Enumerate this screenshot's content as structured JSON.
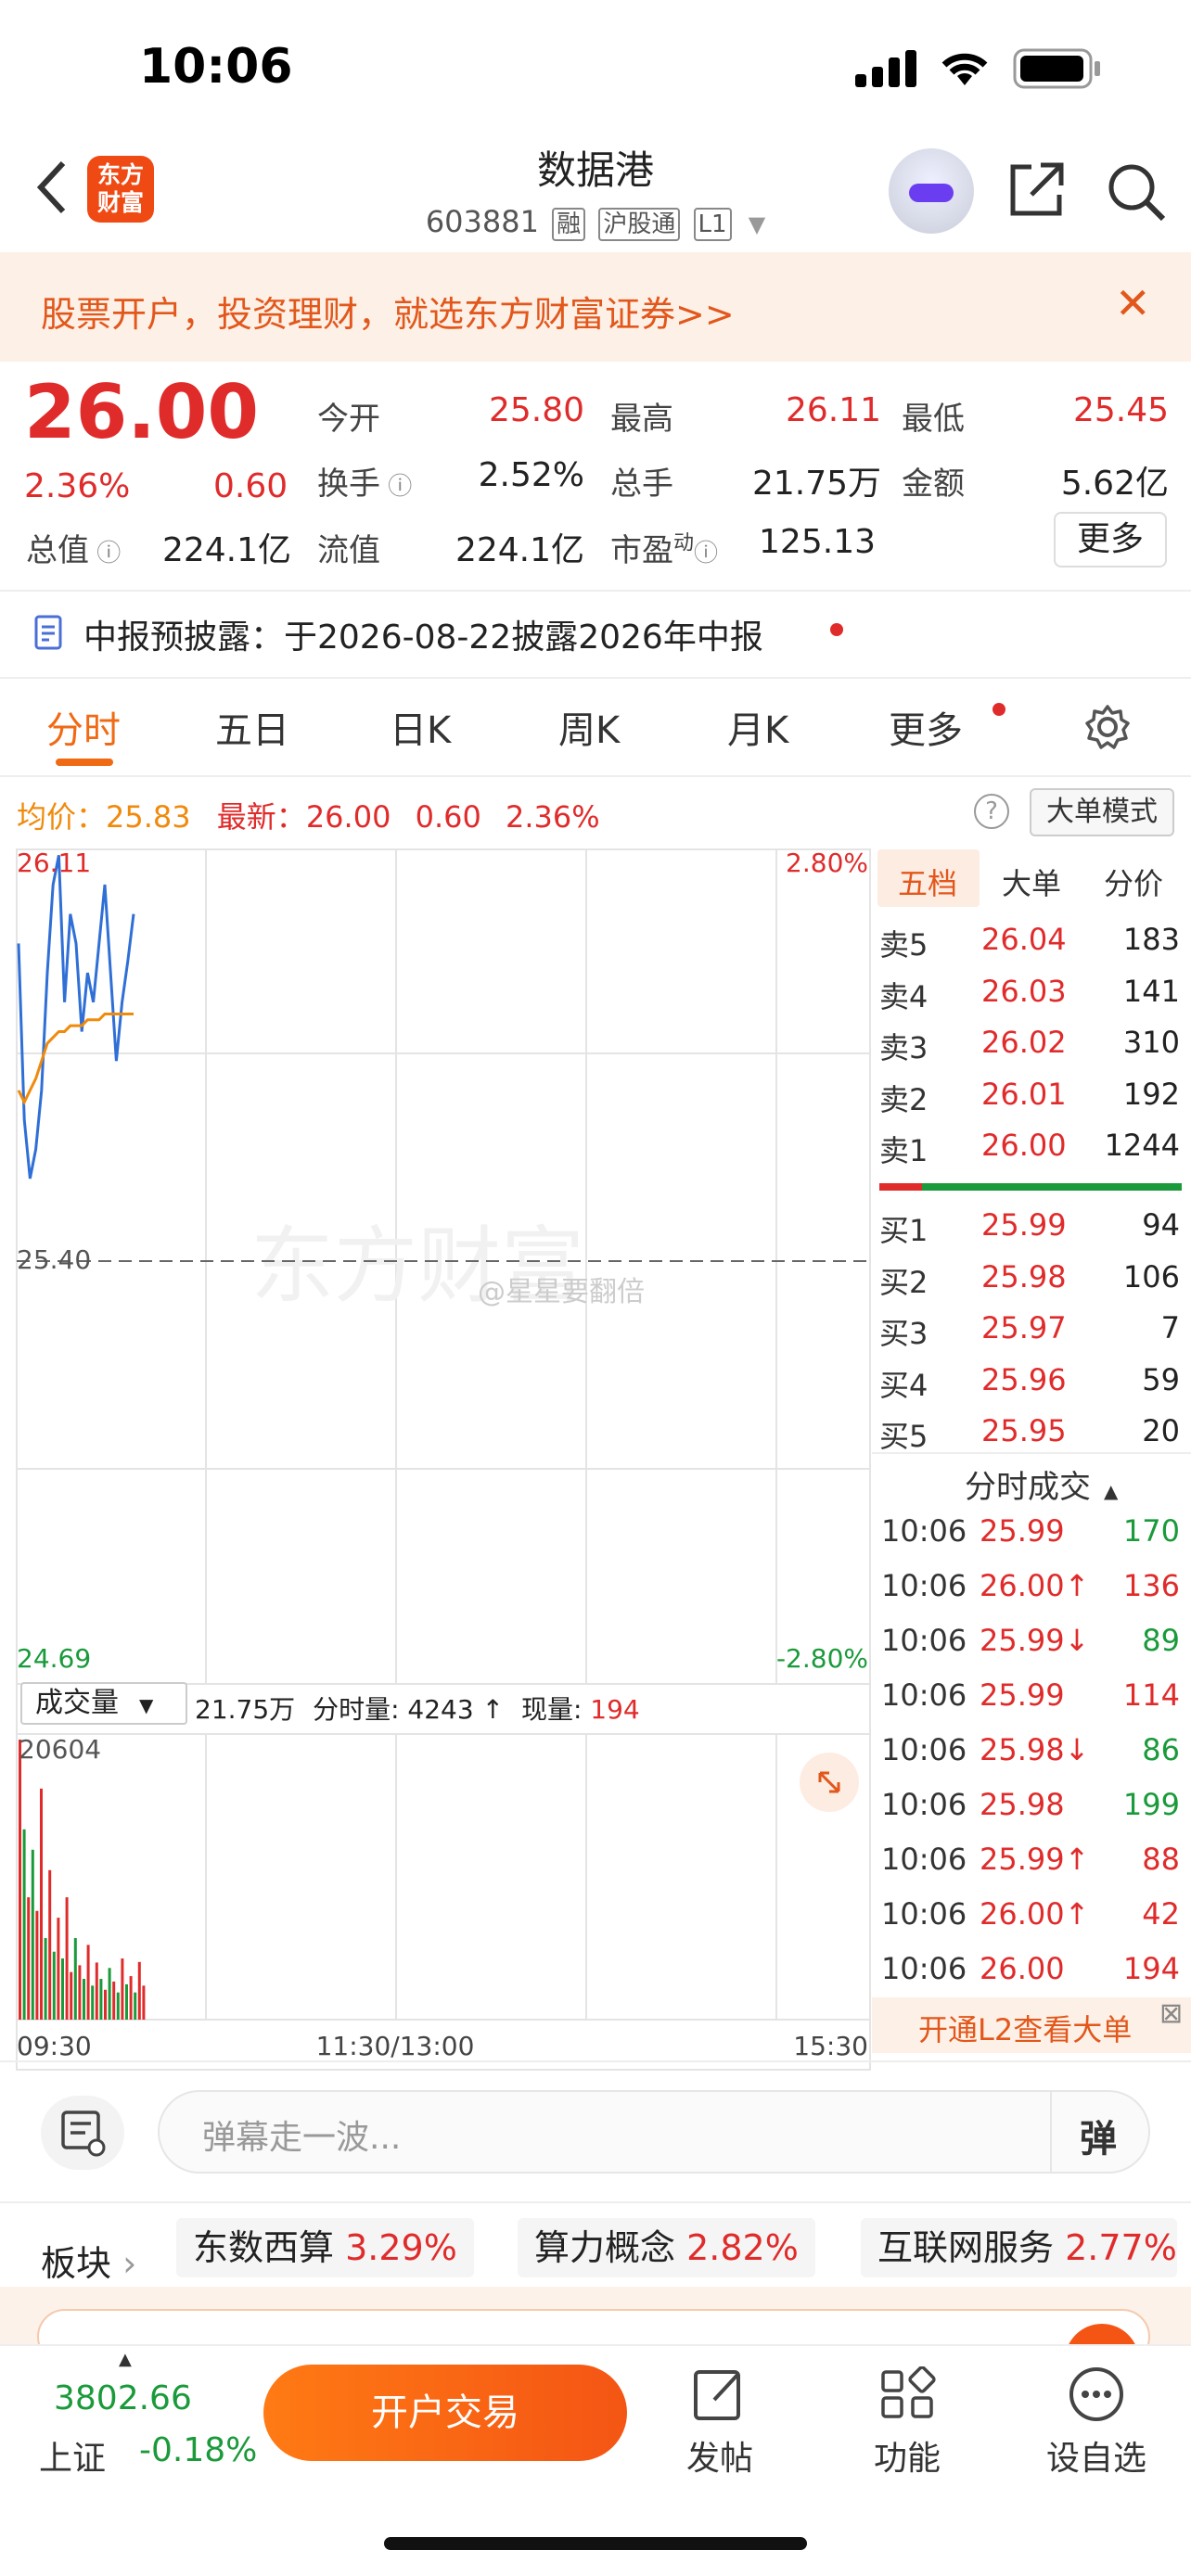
{
  "status": {
    "time": "10:06"
  },
  "header": {
    "logo_text": "东方\n财富",
    "title": "数据港",
    "code": "603881",
    "tags": [
      "融",
      "沪股通",
      "L1"
    ]
  },
  "promo": {
    "text": "股票开户，投资理财，就选东方财富证券>>"
  },
  "quote": {
    "price": "26.00",
    "change_pct": "2.36%",
    "change": "0.60",
    "open_label": "今开",
    "open": "25.80",
    "high_label": "最高",
    "high": "26.11",
    "low_label": "最低",
    "low": "25.45",
    "turnover_label": "换手",
    "turnover": "2.52%",
    "volume_label": "总手",
    "volume": "21.75万",
    "amount_label": "金额",
    "amount": "5.62亿",
    "mcap_label": "总值",
    "mcap": "224.1亿",
    "float_label": "流值",
    "float": "224.1亿",
    "pe_label": "市盈",
    "pe_sup": "动",
    "pe": "125.13",
    "more": "更多"
  },
  "notice": {
    "text": "中报预披露：于2026-08-22披露2026年中报"
  },
  "tabs": [
    "分时",
    "五日",
    "日K",
    "周K",
    "月K",
    "更多"
  ],
  "chart_info": {
    "avg_label": "均价：",
    "avg": "25.83",
    "last_label": "最新：",
    "last": "26.00",
    "chg": "0.60",
    "pct": "2.36%",
    "mode_button": "大单模式",
    "y_top": "26.11",
    "y_mid": "25.40",
    "y_bottom": "24.69",
    "pct_top": "2.80%",
    "pct_bottom": "-2.80%",
    "watermark": "东方财富",
    "weibo_mark": "@星星要翻倍",
    "vol_selector": "成交量",
    "vol_info_total": "21.75万",
    "vol_info_min_label": "分时量:",
    "vol_info_min": "4243",
    "vol_info_now_label": "现量:",
    "vol_info_now": "194",
    "vol_max": "20604",
    "x_start": "09:30",
    "x_mid": "11:30/13:00",
    "x_end": "15:30"
  },
  "chart_data": {
    "type": "line",
    "title": "",
    "ylim": [
      24.69,
      26.11
    ],
    "reference": 25.4,
    "series": [
      {
        "color": "#2f6fd6",
        "values": [
          25.95,
          25.65,
          25.55,
          25.6,
          25.7,
          25.9,
          26.05,
          26.1,
          25.85,
          26.0,
          25.95,
          25.8,
          25.9,
          25.85,
          25.95,
          26.05,
          25.9,
          25.75,
          25.85,
          25.92,
          26.0
        ]
      },
      {
        "color": "#f08a0c",
        "values": [
          25.7,
          25.68,
          25.7,
          25.72,
          25.75,
          25.78,
          25.79,
          25.8,
          25.8,
          25.81,
          25.81,
          25.81,
          25.82,
          25.82,
          25.82,
          25.83,
          25.83,
          25.83,
          25.83,
          25.83,
          25.83
        ]
      }
    ],
    "volume": {
      "max": 20604,
      "values": [
        20604,
        14000,
        9000,
        12500,
        8000,
        17000,
        6000,
        11000,
        5000,
        7500,
        4500,
        9000,
        3500,
        6000,
        4000,
        3000,
        5500,
        2500,
        4200,
        3000,
        2200,
        3800,
        2800,
        2000,
        4500,
        2600,
        3200,
        2000,
        4243,
        2500
      ],
      "up": [
        true,
        false,
        true,
        false,
        true,
        true,
        false,
        true,
        false,
        true,
        false,
        true,
        true,
        false,
        true,
        false,
        true,
        false,
        true,
        false,
        true,
        false,
        true,
        false,
        true,
        false,
        true,
        false,
        true,
        true
      ]
    }
  },
  "orderbook": {
    "tabs": [
      "五档",
      "大单",
      "分价"
    ],
    "asks": [
      {
        "label": "卖5",
        "price": "26.04",
        "vol": "183"
      },
      {
        "label": "卖4",
        "price": "26.03",
        "vol": "141"
      },
      {
        "label": "卖3",
        "price": "26.02",
        "vol": "310"
      },
      {
        "label": "卖2",
        "price": "26.01",
        "vol": "192"
      },
      {
        "label": "卖1",
        "price": "26.00",
        "vol": "1244"
      }
    ],
    "bids": [
      {
        "label": "买1",
        "price": "25.99",
        "vol": "94"
      },
      {
        "label": "买2",
        "price": "25.98",
        "vol": "106"
      },
      {
        "label": "买3",
        "price": "25.97",
        "vol": "7"
      },
      {
        "label": "买4",
        "price": "25.96",
        "vol": "59"
      },
      {
        "label": "买5",
        "price": "25.95",
        "vol": "20"
      }
    ],
    "ratio_sell": 0.14
  },
  "ticks": {
    "title": "分时成交",
    "rows": [
      {
        "t": "10:06",
        "p": "25.99",
        "v": "170",
        "pc": "red",
        "vc": "green"
      },
      {
        "t": "10:06",
        "p": "26.00↑",
        "v": "136",
        "pc": "red",
        "vc": "red"
      },
      {
        "t": "10:06",
        "p": "25.99↓",
        "v": "89",
        "pc": "red",
        "vc": "green"
      },
      {
        "t": "10:06",
        "p": "25.99",
        "v": "114",
        "pc": "red",
        "vc": "red"
      },
      {
        "t": "10:06",
        "p": "25.98↓",
        "v": "86",
        "pc": "red",
        "vc": "green"
      },
      {
        "t": "10:06",
        "p": "25.98",
        "v": "199",
        "pc": "red",
        "vc": "green"
      },
      {
        "t": "10:06",
        "p": "25.99↑",
        "v": "88",
        "pc": "red",
        "vc": "red"
      },
      {
        "t": "10:06",
        "p": "26.00↑",
        "v": "42",
        "pc": "red",
        "vc": "red"
      },
      {
        "t": "10:06",
        "p": "26.00",
        "v": "194",
        "pc": "red",
        "vc": "red"
      }
    ],
    "l2_banner": "开通L2查看大单"
  },
  "danmu": {
    "placeholder": "弹幕走一波...",
    "btn": "弹"
  },
  "sectors": {
    "label": "板块",
    "items": [
      {
        "name": "东数西算",
        "pct": "3.29%"
      },
      {
        "name": "算力概念",
        "pct": "2.82%"
      },
      {
        "name": "互联网服务",
        "pct": "2.77%"
      }
    ]
  },
  "bottom": {
    "index_value": "3802.66",
    "index_name": "上证",
    "index_pct": "-0.18%",
    "trade": "开户交易",
    "post": "发帖",
    "func": "功能",
    "watch": "设自选"
  }
}
